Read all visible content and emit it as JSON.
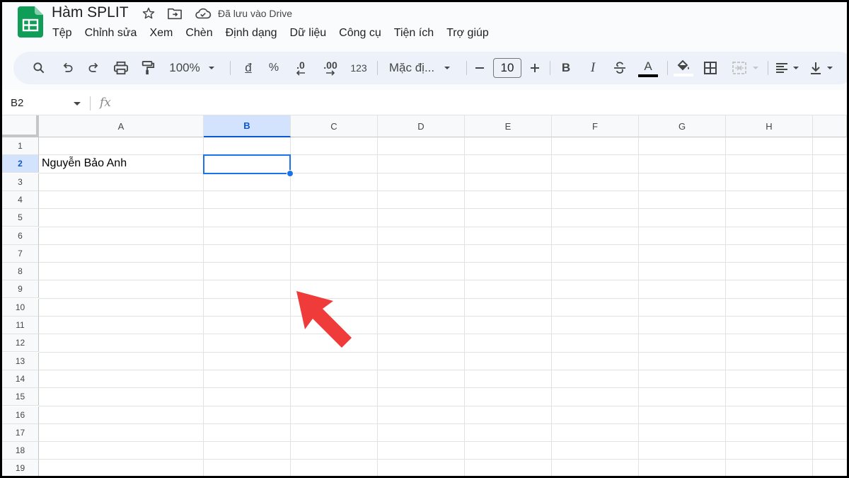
{
  "app": {
    "title": "Hàm SPLIT",
    "save_status": "Đã lưu vào Drive",
    "accent": "#0b57d0",
    "brand": "#0f9d58"
  },
  "menu": [
    "Tệp",
    "Chỉnh sửa",
    "Xem",
    "Chèn",
    "Định dạng",
    "Dữ liệu",
    "Công cụ",
    "Tiện ích",
    "Trợ giúp"
  ],
  "toolbar": {
    "zoom": "100%",
    "currency": "đ",
    "percent": "%",
    "decrease_decimal": ".0",
    "increase_decimal": ".00",
    "number_format": "123",
    "font": "Mặc đị...",
    "font_size": "10",
    "bold": "B",
    "italic": "I",
    "text_color_letter": "A"
  },
  "formula_bar": {
    "name_box": "B2",
    "fx": "fx",
    "formula": ""
  },
  "sheet": {
    "columns": [
      "A",
      "B",
      "C",
      "D",
      "E",
      "F",
      "G",
      "H"
    ],
    "rows": [
      "1",
      "2",
      "3",
      "4",
      "5",
      "6",
      "7",
      "8",
      "9",
      "10",
      "11",
      "12",
      "13",
      "14",
      "15",
      "16",
      "17",
      "18",
      "19"
    ],
    "active_col": "B",
    "active_row": "2",
    "cells": {
      "A2": "Nguyễn Bảo Anh"
    }
  },
  "annotation": {
    "arrow_color": "#f03b3b"
  }
}
